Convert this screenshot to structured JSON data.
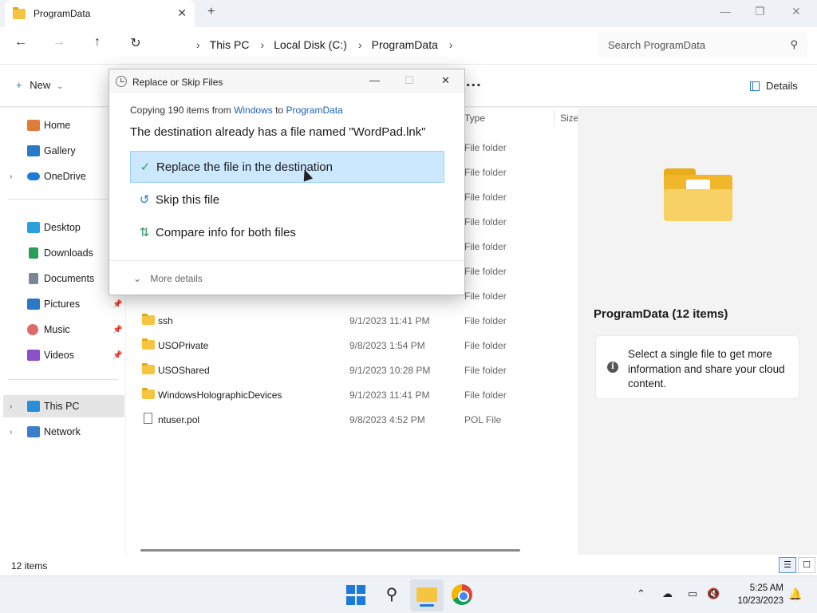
{
  "window": {
    "tab_title": "ProgramData",
    "tab_close": "✕",
    "new_tab": "+",
    "minimize": "—",
    "restore": "❐",
    "close": "✕"
  },
  "nav": {
    "back": "←",
    "forward": "→",
    "up": "↑",
    "refresh": "↻",
    "breadcrumb": [
      "This PC",
      "Local Disk (C:)",
      "ProgramData"
    ],
    "breadcrumb_sep": "›",
    "search_placeholder": "Search ProgramData"
  },
  "command_bar": {
    "new_label": "New",
    "new_plus": "+",
    "new_chevron": "⌄",
    "more": "...",
    "details_label": "Details"
  },
  "sidebar": {
    "chevron": "›",
    "pin": "📌",
    "items": [
      {
        "label": "Home",
        "color": "#e07b39"
      },
      {
        "label": "Gallery",
        "color": "#2a79c9"
      },
      {
        "label": "OneDrive",
        "color": "#1e7ad8"
      },
      {
        "label": "Desktop",
        "color": "#2aa0dd"
      },
      {
        "label": "Downloads",
        "color": "#2a9d5b"
      },
      {
        "label": "Documents",
        "color": "#7a8696"
      },
      {
        "label": "Pictures",
        "color": "#2a79c9"
      },
      {
        "label": "Music",
        "color": "#e06a6a"
      },
      {
        "label": "Videos",
        "color": "#8a4fc9"
      },
      {
        "label": "This PC",
        "color": "#2a8fd6"
      },
      {
        "label": "Network",
        "color": "#3a7fc9"
      }
    ]
  },
  "file_list": {
    "columns": {
      "type": "Type",
      "size": "Size"
    },
    "hidden_rows_type": [
      "File folder",
      "File folder",
      "File folder",
      "File folder",
      "File folder",
      "File folder",
      "File folder"
    ],
    "rows": [
      {
        "name": "ssh",
        "date": "9/1/2023 11:41 PM",
        "type": "File folder",
        "kind": "folder"
      },
      {
        "name": "USOPrivate",
        "date": "9/8/2023 1:54 PM",
        "type": "File folder",
        "kind": "folder"
      },
      {
        "name": "USOShared",
        "date": "9/1/2023 10:28 PM",
        "type": "File folder",
        "kind": "folder"
      },
      {
        "name": "WindowsHolographicDevices",
        "date": "9/1/2023 11:41 PM",
        "type": "File folder",
        "kind": "folder"
      },
      {
        "name": "ntuser.pol",
        "date": "9/8/2023 4:52 PM",
        "type": "POL File",
        "kind": "file"
      }
    ]
  },
  "details_pane": {
    "title": "ProgramData (12 items)",
    "info_icon": "i",
    "info_text": "Select a single file to get more information and share your cloud content."
  },
  "status_bar": {
    "item_count": "12 items",
    "view_details": "☰",
    "view_tiles": "☐"
  },
  "dialog": {
    "title": "Replace or Skip Files",
    "minimize": "—",
    "maximize": "☐",
    "close": "✕",
    "copy_prefix": "Copying 190 items from ",
    "copy_source": "Windows",
    "copy_mid": " to ",
    "copy_dest": "ProgramData",
    "message": "The destination already has a file named \"WordPad.lnk\"",
    "options": [
      {
        "icon": "✓",
        "label": "Replace the file in the destination",
        "icon_color": "#2a9d5b"
      },
      {
        "icon": "↺",
        "label": "Skip this file",
        "icon_color": "#1e7ad8"
      },
      {
        "icon": "⇅",
        "label": "Compare info for both files",
        "icon_color": "#2a9d5b"
      }
    ],
    "more_chevron": "⌄",
    "more_details": "More details"
  },
  "taskbar": {
    "search_icon": "⚲",
    "tray_up": "⌃",
    "tray_net": "☁",
    "tray_display": "▭",
    "tray_sound": "🔇",
    "time": "5:25 AM",
    "date": "10/23/2023",
    "bell": "🔔"
  }
}
